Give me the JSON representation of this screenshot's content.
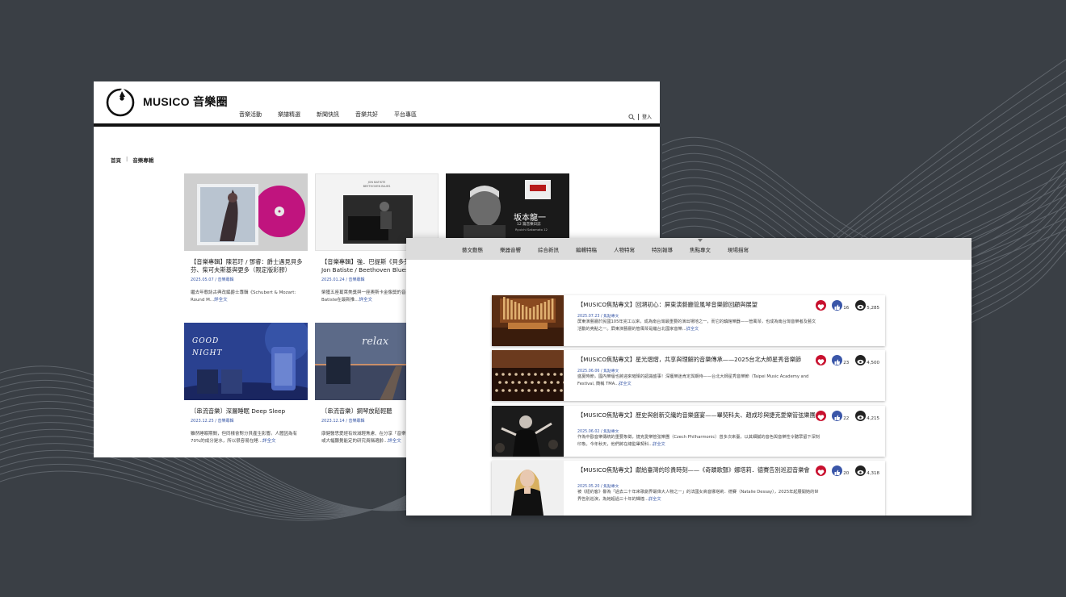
{
  "window1": {
    "brand": "MUSICO 音樂圈",
    "nav": [
      "音樂活動",
      "樂譜精選",
      "新聞快訊",
      "音樂共好",
      "平台專區"
    ],
    "login": "登入",
    "breadcrumb": {
      "home": "首頁",
      "current": "音樂專輯"
    },
    "cards": [
      {
        "title": "【音樂專輯】陳若玗 / 鄧睿：爵士遇見貝多芬、柴可夫斯基與更多（限定版彩膠）",
        "meta": "2025.05.07 / 音樂專輯",
        "desc": "繼去年歌詠古典改編爵士專輯《Schubert & Mozart: Round M...",
        "more": "詳全文"
      },
      {
        "title": "【音樂專輯】強．巴提斯《貝多芬藍調》 Jon Batiste / Beethoven Blues",
        "meta": "2025.01.24 / 音樂專輯",
        "desc": "榮獲五座葛萊美獎與一座奧斯卡金像獎的音樂家Jon Batiste在最新推...",
        "more": "詳全文",
        "cover_line1": "JON BATISTE",
        "cover_line2": "BEETHOVEN BLUES"
      },
      {
        "cover_title": "坂本龍一",
        "cover_sub1": "12 篇音樂日誌",
        "cover_sub2": "Ryuichi Sakamoto 12"
      },
      {
        "title": "〔串流音樂〕深層睡眠 Deep Sleep",
        "meta": "2023.12.25 / 音樂專輯",
        "desc": "雖然睡眠期間，但同樣會對分貝產生影響。人體因為有70%的成分是水，所以很容易在睡...",
        "more": "詳全文",
        "cover_text": "GOOD NIGHT"
      },
      {
        "title": "〔串流音樂〕鋼琴放鬆輕聽",
        "meta": "2023.12.14 / 音樂專輯",
        "desc": "康健醫思愛經有效減輕焦慮、在分享「音樂治療」功效，或大幅聽覺能定的研究員稱適齡...",
        "more": "詳全文",
        "cover_text": "relax"
      }
    ]
  },
  "window2": {
    "nav": [
      "藝文動態",
      "樂器音響",
      "綜合新訊",
      "編輯特稿",
      "人物特寫",
      "特別報導",
      "焦點專文",
      "現場描寫"
    ],
    "active_nav": "焦點專文",
    "articles": [
      {
        "title": "【MUSICO焦點專文】回溯初心：屏東演藝廳管風琴音樂節回顧與展望",
        "meta": "2025.07.23 / 焦點專文",
        "desc": "屏東演藝廳於民國105年完工以來，成為南台灣最重要的演出場地之一，而它的鎮館樂器——管風琴，也成為南台灣音樂者及藝文活動的亮點之一。屏東演藝廳的管風琴是繼台北國家音樂...",
        "more": "詳全文",
        "likes": "16",
        "views": "5,285"
      },
      {
        "title": "【MUSICO焦點專文】星光熠熠，共享與理解的音樂傳承——2025台北大師星秀音樂節",
        "meta": "2025.06.06 / 焦點專文",
        "desc": "盛夏時節，國內樂壇也將迎來璀璨的認識盛事！深獲樂迷肯定與期待——台北大師星秀音樂節（Taipei Music Academy and Festival, 簡稱 TMA...",
        "more": "詳全文",
        "likes": "23",
        "views": "4,500"
      },
      {
        "title": "【MUSICO焦點專文】歷史與創新交織的音樂盛宴——畢契科夫、趙成珍與捷克愛樂管弦樂團",
        "meta": "2025.06.02 / 焦點專文",
        "desc": "作為中歐音樂傳統的重要象徵，捷克愛樂管弦樂團（Czech Philharmonic）曾多次來臺，以其細膩的音色與音樂性令聽眾留下深刻印象。今年秋天，他們將在總監畢契科...",
        "more": "詳全文",
        "likes": "22",
        "views": "4,215"
      },
      {
        "title": "【MUSICO焦點專文】獻給臺灣的珍貴時刻——《奇蹟歌聲》娜塔莉．德賽告別巡迴音樂會",
        "meta": "2025.05.20 / 焦點專文",
        "desc": "被《紐約客》譽為「過去二十年來歌劇界最偉大人物之一」的法國女高音娜塔莉．德賽（Natalie Dessay），2025年起展開她的世界告別巡演，為她超過三十年的輝煌...",
        "more": "詳全文",
        "likes": "20",
        "views": "4,318"
      }
    ]
  },
  "colors": {
    "background": "#3a3f45",
    "accent_blue": "#3b5aa8",
    "heart_red": "#c8102e"
  }
}
